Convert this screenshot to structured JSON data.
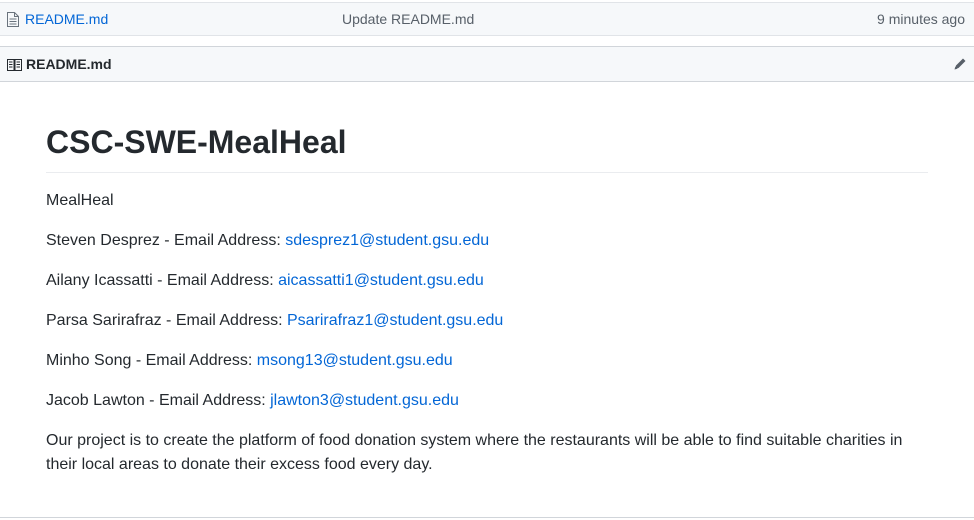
{
  "file_row": {
    "icon": "file-icon",
    "name": "README.md",
    "commit_message": "Update README.md",
    "age": "9 minutes ago"
  },
  "readme_header": {
    "icon": "book-icon",
    "title": "README.md",
    "edit_icon": "pencil-icon"
  },
  "readme": {
    "heading": "CSC-SWE-MealHeal",
    "intro": "MealHeal",
    "members": [
      {
        "prefix": "Steven Desprez - Email Address: ",
        "email": "sdesprez1@student.gsu.edu"
      },
      {
        "prefix": "Ailany Icassatti - Email Address: ",
        "email": "aicassatti1@student.gsu.edu"
      },
      {
        "prefix": "Parsa Sarirafraz - Email Address: ",
        "email": "Psarirafraz1@student.gsu.edu"
      },
      {
        "prefix": "Minho Song - Email Address: ",
        "email": "msong13@student.gsu.edu"
      },
      {
        "prefix": "Jacob Lawton - Email Address: ",
        "email": "jlawton3@student.gsu.edu"
      }
    ],
    "description": "Our project is to create the platform of food donation system where the restaurants will be able to find suitable charities in their local areas to donate their excess food every day."
  },
  "colors": {
    "link": "#0366d6",
    "text": "#24292e",
    "muted": "#586069",
    "header_bg": "#f6f8fa",
    "border": "#d1d5da"
  }
}
